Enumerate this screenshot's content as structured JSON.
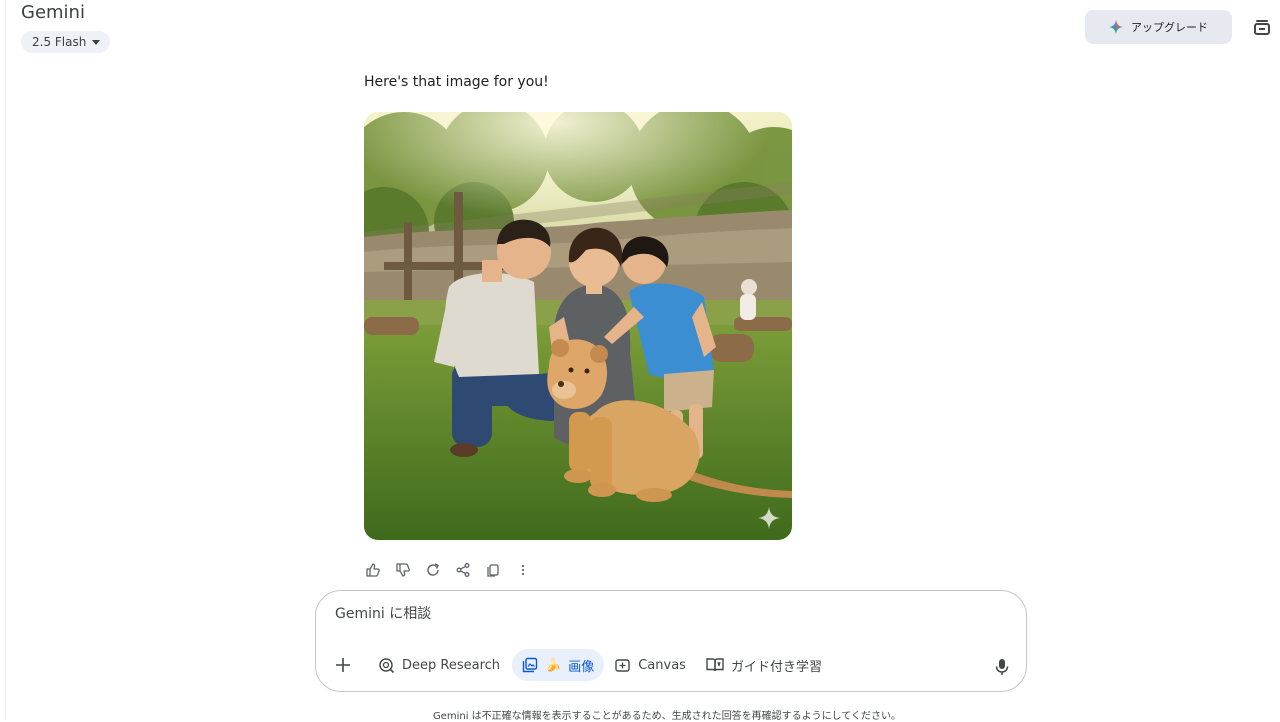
{
  "header": {
    "app_title": "Gemini",
    "model_label": "2.5 Flash",
    "upgrade_label": "アップグレード"
  },
  "message": {
    "text": "Here's that image for you!"
  },
  "composer": {
    "placeholder": "Gemini に相談",
    "tools": [
      {
        "label": "Deep Research",
        "icon": "deep-research-icon"
      },
      {
        "label": "画像",
        "icon": "image-icon",
        "emoji": "🍌",
        "active": true
      },
      {
        "label": "Canvas",
        "icon": "canvas-icon"
      },
      {
        "label": "ガイド付き学習",
        "icon": "guided-learning-icon"
      }
    ]
  },
  "footer": {
    "disclaimer": "Gemini は不正確な情報を表示することがあるため、生成された回答を再確認するようにしてください。"
  },
  "colors": {
    "accent": "#0b57d0",
    "chip_bg": "#eef1f5",
    "upgrade_bg": "#e6eaf0",
    "active_tool_bg": "#e9f0fd"
  }
}
